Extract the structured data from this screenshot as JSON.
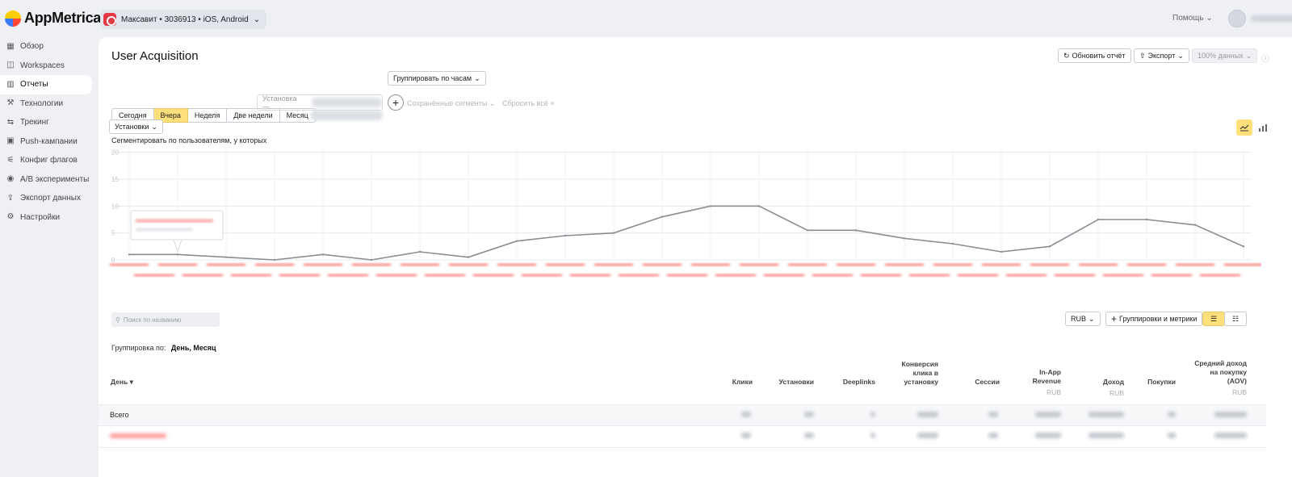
{
  "app": {
    "logo_text": "AppMetrica",
    "app_switch": "Максавит • 3036913 • iOS, Android",
    "help_label": "Помощь"
  },
  "sidebar": {
    "items": [
      {
        "label": "Обзор",
        "icon": "grid-icon",
        "active": false
      },
      {
        "label": "Workspaces",
        "icon": "workspaces-icon",
        "active": false
      },
      {
        "label": "Отчеты",
        "icon": "reports-icon",
        "active": true
      },
      {
        "label": "Технологии",
        "icon": "wrench-icon",
        "active": false
      },
      {
        "label": "Трекинг",
        "icon": "tracking-icon",
        "active": false
      },
      {
        "label": "Push-кампании",
        "icon": "push-icon",
        "active": false
      },
      {
        "label": "Конфиг флагов",
        "icon": "flags-icon",
        "active": false
      },
      {
        "label": "A/B эксперименты",
        "icon": "ab-icon",
        "active": false
      },
      {
        "label": "Экспорт данных",
        "icon": "export-icon",
        "active": false
      },
      {
        "label": "Настройки",
        "icon": "gear-icon",
        "active": false
      }
    ]
  },
  "page": {
    "title": "User Acquisition",
    "refresh_label": "Обновить отчёт",
    "export_label": "Экспорт",
    "data_percent_label": "100% данных"
  },
  "period": {
    "tabs": [
      "Сегодня",
      "Вчера",
      "Неделя",
      "Две недели",
      "Месяц"
    ],
    "selected": "Вчера",
    "group_by_label": "Группировать по часам"
  },
  "segment": {
    "label": "Сегментировать по пользователям, у которых",
    "input_text": "Установка —",
    "saved_segments": "Сохранённые сегменты",
    "reset_all": "Сбросить всё"
  },
  "metric_select": "Установки",
  "chart_data": {
    "type": "line",
    "series": [
      {
        "values": [
          1,
          1,
          0.5,
          0,
          1,
          0,
          1.5,
          0.5,
          3.5,
          4.5,
          5,
          8,
          10,
          10,
          5.5,
          5.5,
          4,
          3,
          1.5,
          2.5,
          7.5,
          7.5,
          6.5,
          2.5
        ]
      }
    ],
    "y_ticks": [
      0,
      5,
      10,
      15,
      20
    ],
    "ylim": [
      0,
      21
    ],
    "grid": true
  },
  "table": {
    "search_placeholder": "Поиск по названию",
    "currency": "RUB",
    "groupings_button": "Группировки и метрики",
    "grouping_label": "Группировка по:",
    "grouping_value": "День, Месяц",
    "columns": [
      {
        "label": "День ▾"
      },
      {
        "label": "Клики"
      },
      {
        "label": "Установки"
      },
      {
        "label": "Deeplinks"
      },
      {
        "label": "Конверсия клика в установку"
      },
      {
        "label": "Сессии"
      },
      {
        "label": "In-App Revenue",
        "unit": "RUB"
      },
      {
        "label": "Доход",
        "unit": "RUB"
      },
      {
        "label": "Покупки"
      },
      {
        "label": "Средний доход на покупку (AOV)",
        "unit": "RUB"
      }
    ],
    "total_label": "Всего"
  }
}
